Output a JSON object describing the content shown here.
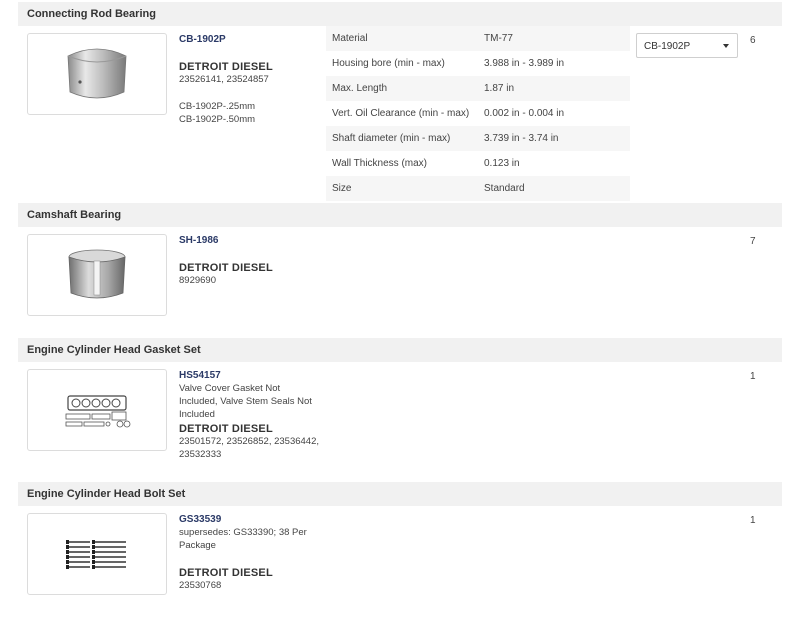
{
  "sections": [
    {
      "title": "Connecting Rod Bearing",
      "part_number": "CB-1902P",
      "brand": "DETROIT DIESEL",
      "oem": "23526141, 23524857",
      "variants": "CB-1902P-.25mm\nCB-1902P-.50mm",
      "quantity": "6",
      "select_value": "CB-1902P",
      "specs": [
        {
          "label": "Material",
          "value": "TM-77"
        },
        {
          "label": "Housing bore (min - max)",
          "value": "3.988 in - 3.989 in"
        },
        {
          "label": "Max. Length",
          "value": "1.87 in"
        },
        {
          "label": "Vert. Oil Clearance (min - max)",
          "value": "0.002 in - 0.004 in"
        },
        {
          "label": "Shaft diameter (min - max)",
          "value": "3.739 in - 3.74 in"
        },
        {
          "label": "Wall Thickness (max)",
          "value": "0.123 in"
        },
        {
          "label": "Size",
          "value": "Standard"
        }
      ]
    },
    {
      "title": "Camshaft Bearing",
      "part_number": "SH-1986",
      "brand": "DETROIT DIESEL",
      "oem": "8929690",
      "quantity": "7"
    },
    {
      "title": "Engine Cylinder Head Gasket Set",
      "part_number": "HS54157",
      "note": "Valve Cover Gasket Not Included, Valve Stem Seals Not Included",
      "brand": "DETROIT DIESEL",
      "oem": "23501572, 23526852, 23536442, 23532333",
      "quantity": "1"
    },
    {
      "title": "Engine Cylinder Head Bolt Set",
      "part_number": "GS33539",
      "note": "supersedes: GS33390; 38 Per Package",
      "brand": "DETROIT DIESEL",
      "oem": "23530768",
      "quantity": "1"
    }
  ],
  "icons": {
    "dropdown": "chevron-down-icon"
  },
  "colors": {
    "part_number": "#2b3a67",
    "header_bg": "#f1f1f1",
    "spec_shade": "#f6f6f6"
  }
}
